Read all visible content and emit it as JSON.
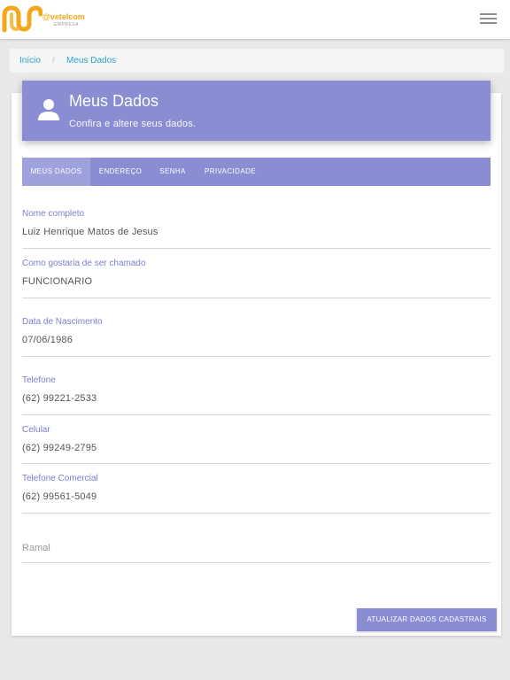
{
  "topbar": {
    "logo_text": "@vetelcom",
    "logo_sub": "EMPRESA"
  },
  "breadcrumb": {
    "home": "Início",
    "separator": "/",
    "current": "Meus Dados"
  },
  "header": {
    "title": "Meus Dados",
    "subtitle": "Confira e altere seus dados."
  },
  "tabs": [
    {
      "label": "MEUS DADOS",
      "active": true
    },
    {
      "label": "ENDEREÇO",
      "active": false
    },
    {
      "label": "SENHA",
      "active": false
    },
    {
      "label": "PRIVACIDADE",
      "active": false
    }
  ],
  "fields": {
    "nome": {
      "label": "Nome completo",
      "value": "Luiz Henrique Matos de Jesus"
    },
    "apelido": {
      "label": "Como gostaria de ser chamado",
      "value": "FUNCIONARIO"
    },
    "nascimento": {
      "label": "Data de Nascimento",
      "value": "07/06/1986"
    },
    "telefone": {
      "label": "Telefone",
      "value": "(62) 99221-2533"
    },
    "celular": {
      "label": "Celular",
      "value": "(62) 99249-2795"
    },
    "comercial": {
      "label": "Telefone Comercial",
      "value": "(62) 99561-5049"
    },
    "ramal": {
      "placeholder": "Ramal"
    }
  },
  "submit_label": "ATUALIZAR DADOS CADASTRAIS",
  "colors": {
    "accent": "#8a8dd2",
    "label": "#7b7fce",
    "link": "#2aa6c7",
    "logo": "#f3a81c"
  },
  "icons": {
    "menu": "hamburger-icon",
    "user": "user-icon"
  }
}
